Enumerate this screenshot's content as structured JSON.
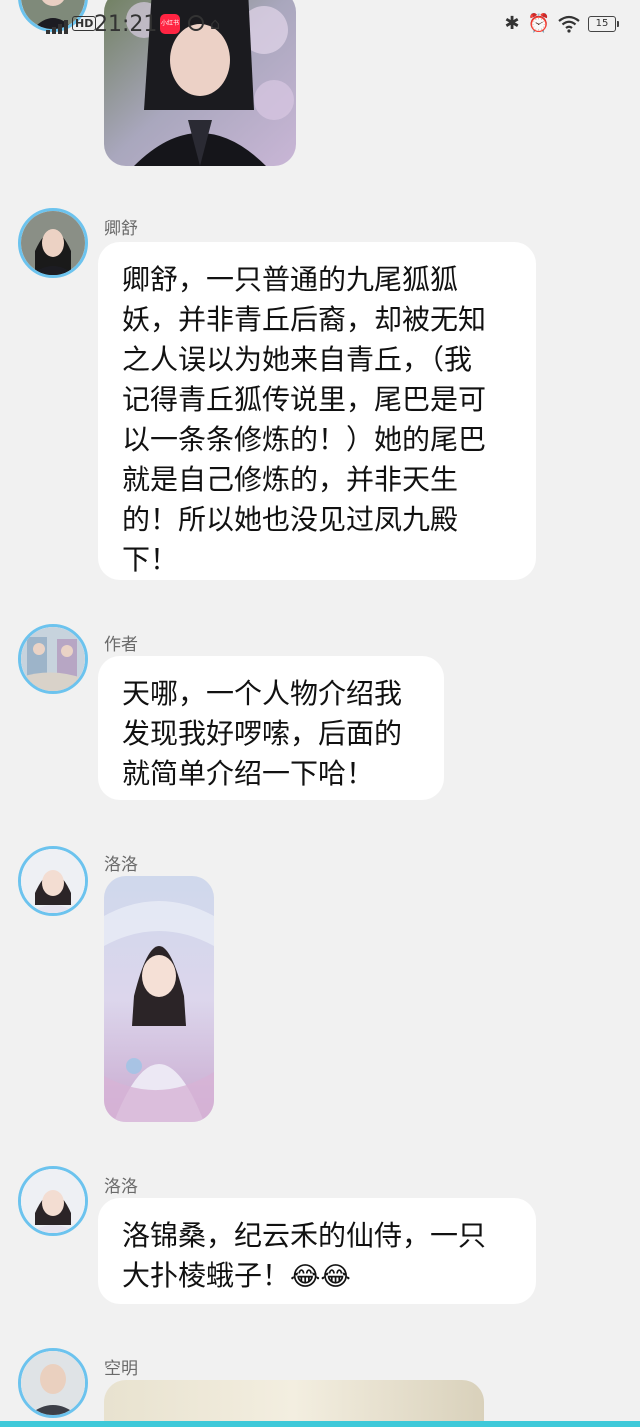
{
  "status_bar": {
    "time": "21:21",
    "hd_label": "HD",
    "battery": "15",
    "icons": [
      "signal-icon",
      "app-icon",
      "sync-icon",
      "bluetooth-icon",
      "alarm-icon",
      "wifi-icon",
      "battery-icon"
    ]
  },
  "messages": [
    {
      "sender": "",
      "type": "image",
      "description_icon": "portrait-photo"
    },
    {
      "sender": "卿舒",
      "type": "text",
      "text": "卿舒，一只普通的九尾狐狐\n妖，并非青丘后裔，却被无知\n之人误以为她来自青丘，（我\n记得青丘狐传说里，尾巴是可\n以一条条修炼的！）她的尾巴\n就是自己修炼的，并非天生\n的！所以她也没见过凤九殿\n下！"
    },
    {
      "sender": "作者",
      "type": "text",
      "text": "天哪，一个人物介绍我\n发现我好啰嗦，后面的\n就简单介绍一下哈！"
    },
    {
      "sender": "洛洛",
      "type": "image",
      "description_icon": "portrait-photo"
    },
    {
      "sender": "洛洛",
      "type": "text",
      "text": "洛锦桑，纪云禾的仙侍，一只\n大扑棱蛾子！",
      "emoji": "😂😂"
    },
    {
      "sender": "空明",
      "type": "image",
      "description_icon": "portrait-photo"
    }
  ],
  "colors": {
    "background": "#f1f1f1",
    "bubble": "#ffffff",
    "avatar_ring": "#6cc3ee",
    "name_text": "#6a6a6a"
  }
}
